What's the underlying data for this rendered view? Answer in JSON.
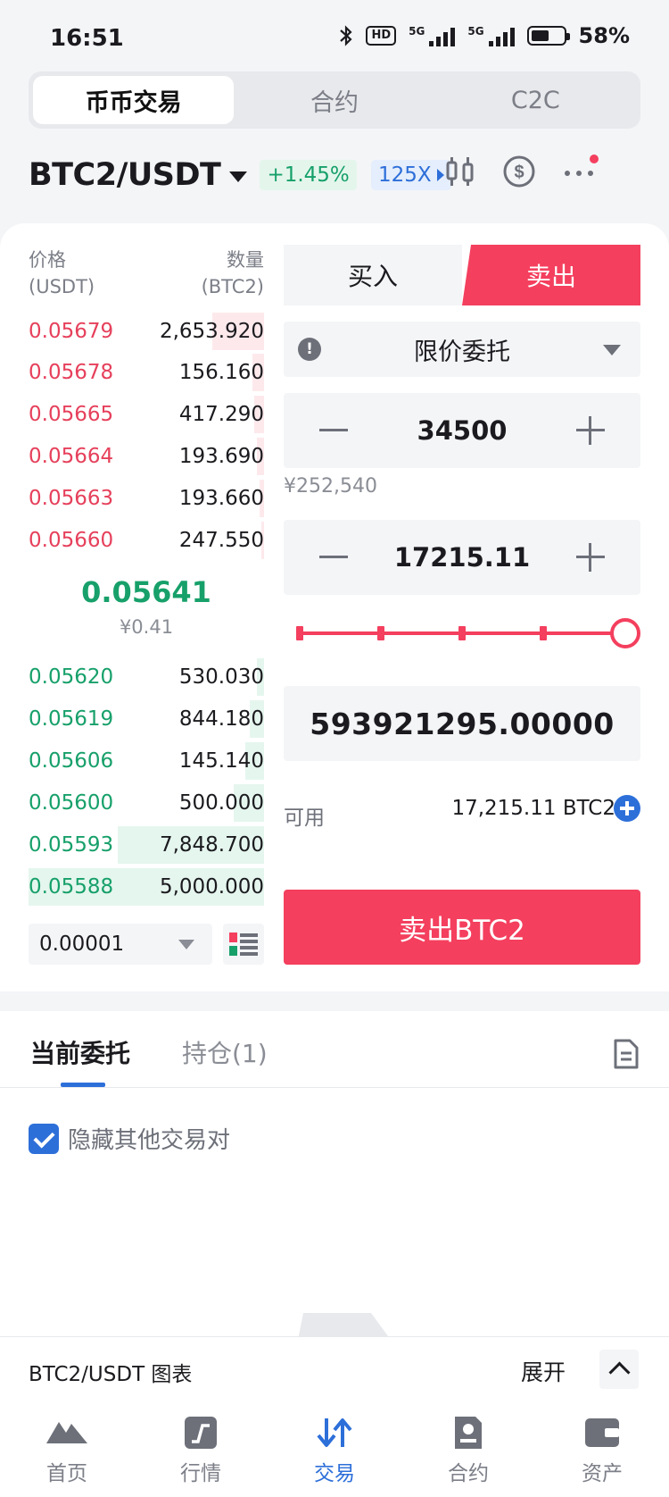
{
  "status_bar": {
    "time": "16:51",
    "hd": "HD",
    "net1": "5G",
    "net2": "5G",
    "battery_pct": "58%",
    "battery_level": 0.58
  },
  "top_tabs": [
    {
      "label": "币币交易",
      "active": true
    },
    {
      "label": "合约",
      "active": false
    },
    {
      "label": "C2C",
      "active": false
    }
  ],
  "pair": {
    "name": "BTC2/USDT",
    "change": "+1.45%",
    "leverage": "125X"
  },
  "order_book": {
    "price_header": "价格",
    "price_unit": "(USDT)",
    "qty_header": "数量",
    "qty_unit": "(BTC2)",
    "asks": [
      {
        "price": "0.05679",
        "qty": "2,653.920",
        "depth": 0.22
      },
      {
        "price": "0.05678",
        "qty": "156.160",
        "depth": 0.05
      },
      {
        "price": "0.05665",
        "qty": "417.290",
        "depth": 0.04
      },
      {
        "price": "0.05664",
        "qty": "193.690",
        "depth": 0.03
      },
      {
        "price": "0.05663",
        "qty": "193.660",
        "depth": 0.02
      },
      {
        "price": "0.05660",
        "qty": "247.550",
        "depth": 0.01
      }
    ],
    "last_price": "0.05641",
    "last_price_cny": "¥0.41",
    "bids": [
      {
        "price": "0.05620",
        "qty": "530.030",
        "depth": 0.03
      },
      {
        "price": "0.05619",
        "qty": "844.180",
        "depth": 0.06
      },
      {
        "price": "0.05606",
        "qty": "145.140",
        "depth": 0.08
      },
      {
        "price": "0.05600",
        "qty": "500.000",
        "depth": 0.13
      },
      {
        "price": "0.05593",
        "qty": "7,848.700",
        "depth": 0.62
      },
      {
        "price": "0.05588",
        "qty": "5,000.000",
        "depth": 1.0
      }
    ],
    "precision": "0.00001"
  },
  "trade_form": {
    "buy_label": "买入",
    "sell_label": "卖出",
    "order_type": "限价委托",
    "price_value": "34500",
    "price_cny": "¥252,540",
    "amount_value": "17215.11",
    "slider_value": 1.0,
    "total_value": "593921295.00000",
    "available_label": "可用",
    "available_value": "17,215.11 BTC2",
    "submit_label": "卖出BTC2"
  },
  "orders_panel": {
    "tab_current": "当前委托",
    "tab_positions": "持仓(1)",
    "hide_other_pairs": "隐藏其他交易对",
    "hide_checked": true
  },
  "chart_strip": {
    "label": "BTC2/USDT 图表",
    "expand": "展开"
  },
  "bottom_nav": [
    {
      "label": "首页",
      "icon": "home-icon",
      "active": false
    },
    {
      "label": "行情",
      "icon": "market-icon",
      "active": false
    },
    {
      "label": "交易",
      "icon": "trade-icon",
      "active": true
    },
    {
      "label": "合约",
      "icon": "contract-icon",
      "active": false
    },
    {
      "label": "资产",
      "icon": "wallet-icon",
      "active": false
    }
  ],
  "colors": {
    "red": "#f43f5e",
    "green": "#17a06a",
    "blue": "#2d6fd9"
  }
}
